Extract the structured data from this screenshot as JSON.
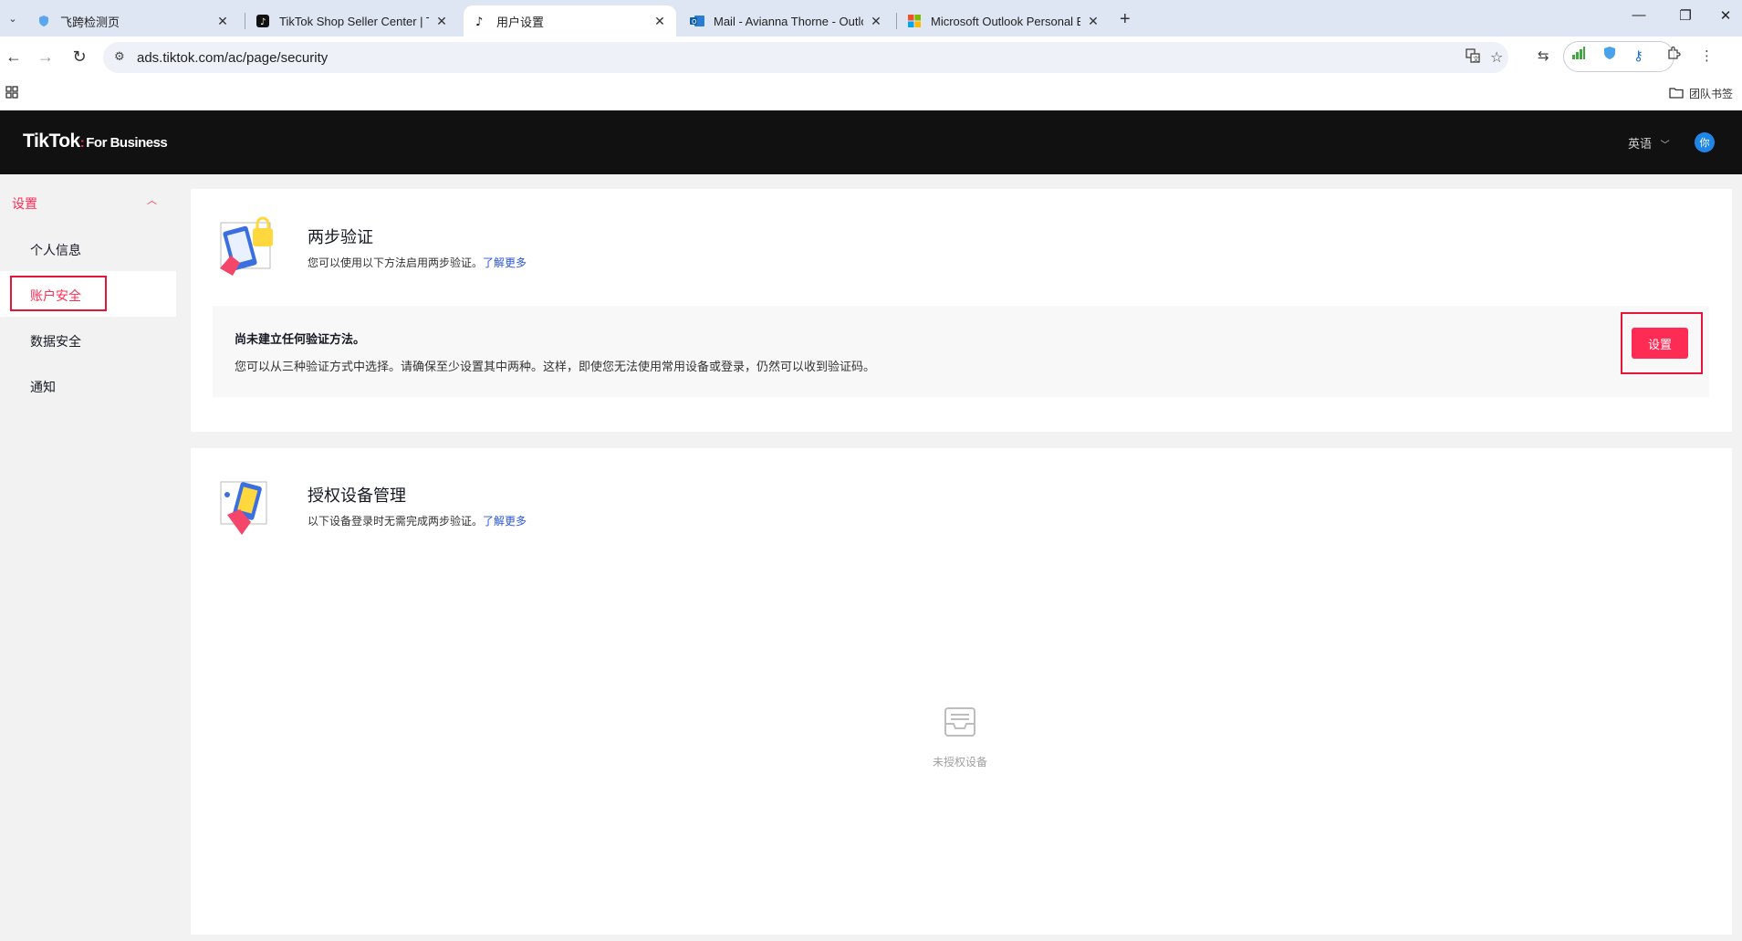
{
  "browser": {
    "tabs": [
      {
        "title": "飞跨检测页",
        "active": false
      },
      {
        "title": "TikTok Shop Seller Center | TikTok",
        "active": false
      },
      {
        "title": "用户设置",
        "active": true
      },
      {
        "title": "Mail - Avianna Thorne - Outlook",
        "active": false
      },
      {
        "title": "Microsoft Outlook Personal Email",
        "active": false
      }
    ],
    "url": "ads.tiktok.com/ac/page/security",
    "bookmark_folder": "团队书签"
  },
  "header": {
    "logo_main": "TikTok",
    "logo_sub": "For Business",
    "language": "英语",
    "avatar_text": "你"
  },
  "sidebar": {
    "section": "设置",
    "items": [
      {
        "label": "个人信息",
        "active": false
      },
      {
        "label": "账户安全",
        "active": true
      },
      {
        "label": "数据安全",
        "active": false
      },
      {
        "label": "通知",
        "active": false
      }
    ]
  },
  "two_step": {
    "title": "两步验证",
    "description": "您可以使用以下方法启用两步验证。",
    "learn_more": "了解更多",
    "notice_title": "尚未建立任何验证方法。",
    "notice_text": "您可以从三种验证方式中选择。请确保至少设置其中两种。这样，即使您无法使用常用设备或登录，仍然可以收到验证码。",
    "button_label": "设置"
  },
  "devices": {
    "title": "授权设备管理",
    "description": "以下设备登录时无需完成两步验证。",
    "learn_more": "了解更多",
    "empty_text": "未授权设备"
  },
  "colors": {
    "accent": "#fe2c55",
    "link": "#2b55d9",
    "header_bg": "#111111"
  }
}
